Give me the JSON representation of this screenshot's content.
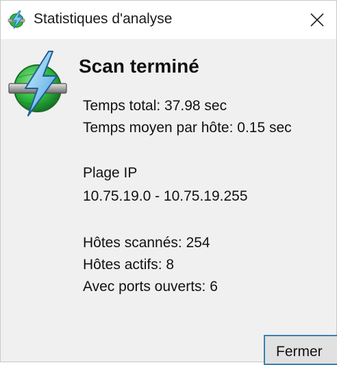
{
  "window": {
    "title": "Statistiques d'analyse"
  },
  "dialog": {
    "heading": "Scan terminé",
    "total_time": "Temps total: 37.98 sec",
    "avg_time_per_host": "Temps moyen par hôte: 0.15 sec",
    "ip_range_label": "Plage IP",
    "ip_range_value": "10.75.19.0 - 10.75.19.255",
    "hosts_scanned": "Hôtes scannés: 254",
    "hosts_alive": "Hôtes actifs: 8",
    "hosts_open_ports": "Avec ports ouverts: 6",
    "close_label": "Fermer"
  },
  "icons": {
    "app": "scanner-bolt-icon",
    "close": "close-icon"
  },
  "colors": {
    "titlebar": "#ffffff",
    "window_bg": "#f0f0f0",
    "globe_green": "#2db83d",
    "bolt_blue": "#5fb8f0",
    "button_border": "#3c7fb1"
  }
}
